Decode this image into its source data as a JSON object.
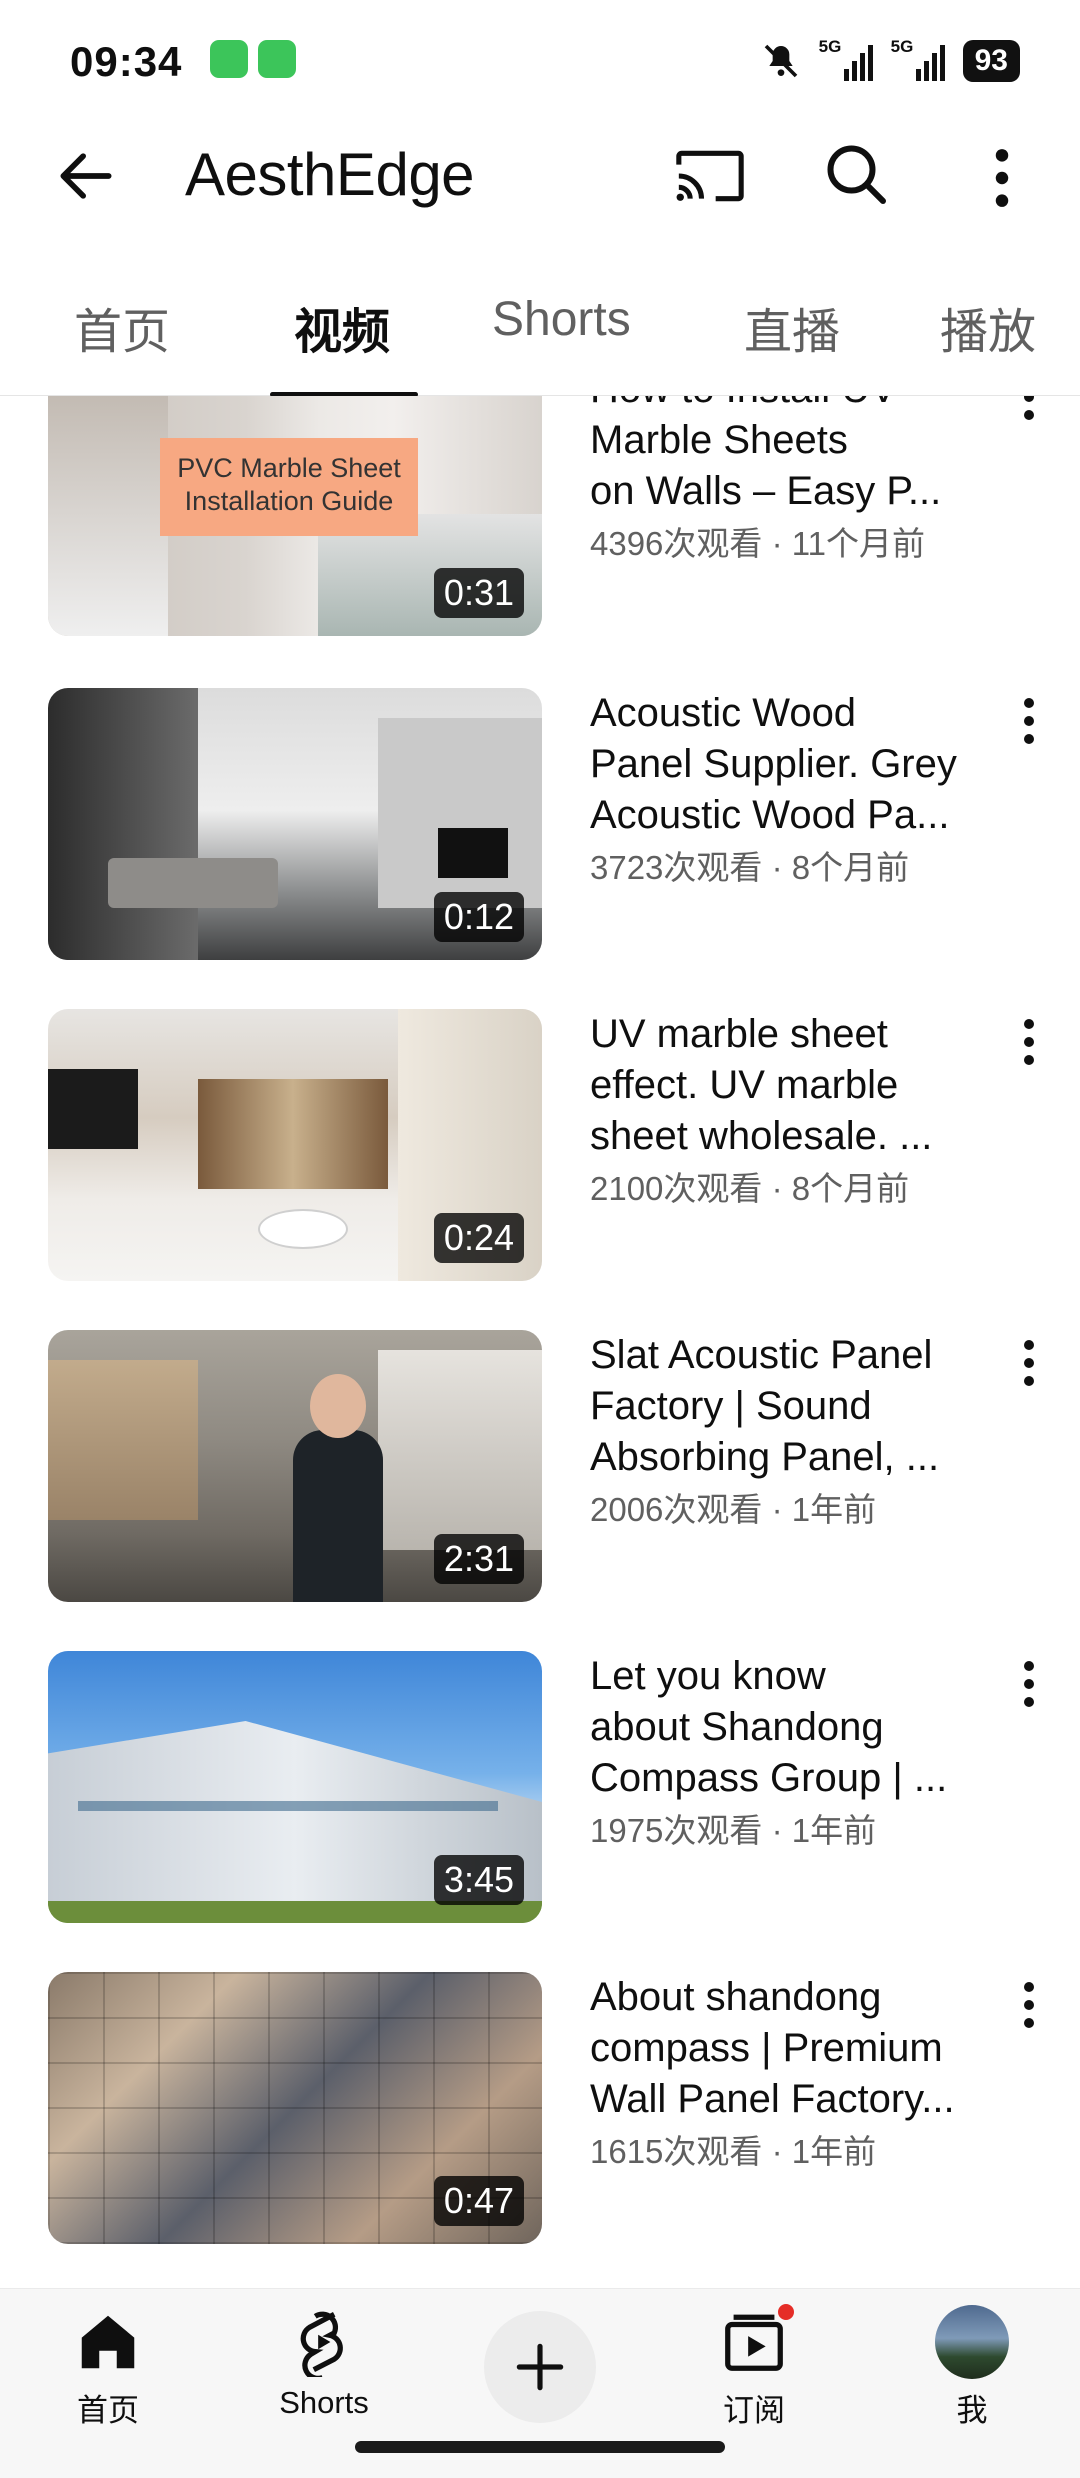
{
  "status_bar": {
    "time": "09:34",
    "battery": "93",
    "network_1": "5G",
    "network_2": "5G"
  },
  "app_bar": {
    "channel_name": "AesthEdge",
    "icons": [
      "back-arrow-icon",
      "cast-icon",
      "search-icon",
      "more-vert-icon"
    ]
  },
  "tabs": [
    {
      "label": "首页",
      "active": false
    },
    {
      "label": "视频",
      "active": true
    },
    {
      "label": "Shorts",
      "active": false
    },
    {
      "label": "直播",
      "active": false
    },
    {
      "label": "播放",
      "active": false
    }
  ],
  "videos": [
    {
      "title_lines": [
        "How to Install UV",
        "Marble Sheets",
        "on Walls – Easy P..."
      ],
      "meta": "4396次观看 · 11个月前",
      "duration": "0:31",
      "thumb_text": "PVC Marble Sheet Installation Guide"
    },
    {
      "title_lines": [
        "Acoustic Wood",
        "Panel Supplier. Grey",
        "Acoustic Wood Pa..."
      ],
      "meta": "3723次观看 · 8个月前",
      "duration": "0:12"
    },
    {
      "title_lines": [
        "UV marble sheet",
        "effect. UV marble",
        "sheet wholesale. ..."
      ],
      "meta": "2100次观看 · 8个月前",
      "duration": "0:24"
    },
    {
      "title_lines": [
        "Slat Acoustic Panel",
        "Factory | Sound",
        "Absorbing Panel, ..."
      ],
      "meta": "2006次观看 · 1年前",
      "duration": "2:31"
    },
    {
      "title_lines": [
        "Let you know",
        "about Shandong",
        "Compass Group | ..."
      ],
      "meta": "1975次观看 · 1年前",
      "duration": "3:45"
    },
    {
      "title_lines": [
        "About shandong",
        "compass | Premium",
        "Wall Panel Factory..."
      ],
      "meta": "1615次观看 · 1年前",
      "duration": "0:47"
    }
  ],
  "bottom_nav": {
    "home_label": "首页",
    "shorts_label": "Shorts",
    "subscriptions_label": "订阅",
    "me_label": "我"
  },
  "colors": {
    "text_primary": "#0f0f0f",
    "text_secondary": "#606060",
    "notification_dot": "#e52d27"
  }
}
